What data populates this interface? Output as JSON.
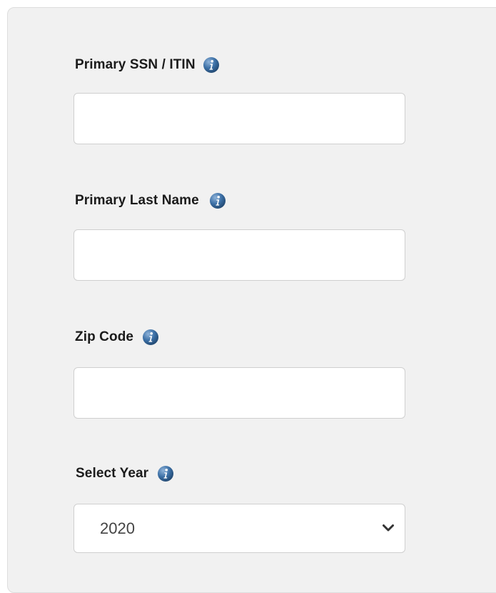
{
  "form": {
    "fields": [
      {
        "label": "Primary SSN / ITIN",
        "value": "",
        "placeholder": ""
      },
      {
        "label": "Primary Last Name",
        "value": "",
        "placeholder": ""
      },
      {
        "label": "Zip Code",
        "value": "",
        "placeholder": ""
      }
    ],
    "year": {
      "label": "Select Year",
      "selected": "2020"
    }
  },
  "icons": {
    "info": "info-icon",
    "dropdown": "chevron-down-icon"
  },
  "colors": {
    "panel_bg": "#f1f1f1",
    "info_icon": "#3b6fa5",
    "label_text": "#1b1b1b"
  }
}
